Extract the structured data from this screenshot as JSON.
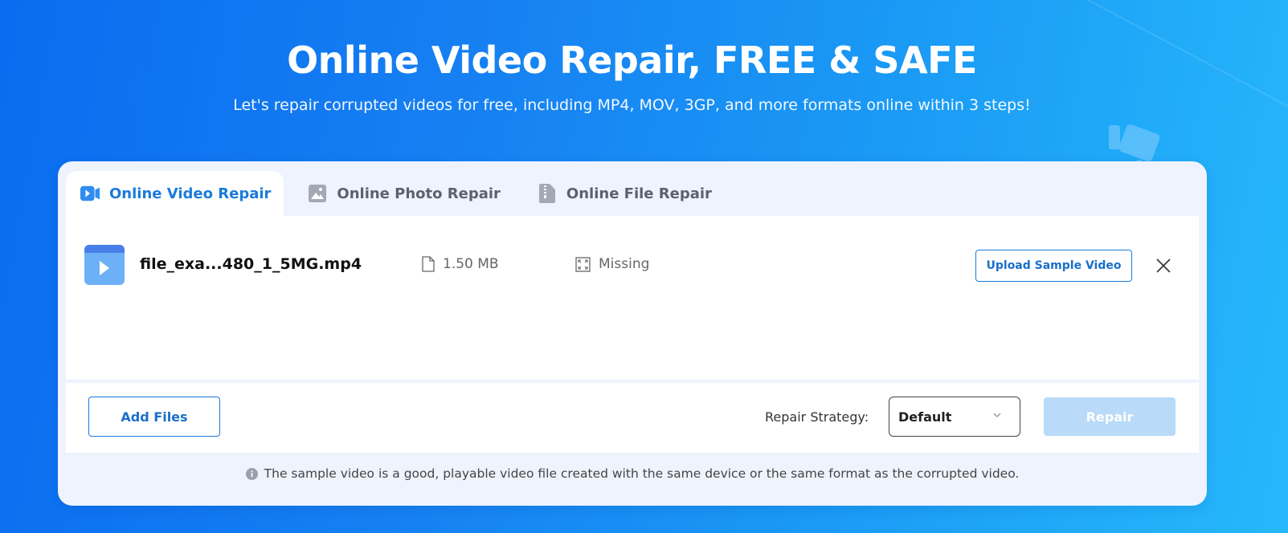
{
  "hero": {
    "title": "Online Video Repair, FREE & SAFE",
    "subtitle": "Let's repair corrupted videos for free, including MP4, MOV, 3GP, and more formats online within 3 steps!"
  },
  "tabs": [
    {
      "label": "Online Video Repair",
      "icon": "video-camera-icon",
      "active": true
    },
    {
      "label": "Online Photo Repair",
      "icon": "image-icon",
      "active": false
    },
    {
      "label": "Online File Repair",
      "icon": "zip-file-icon",
      "active": false
    }
  ],
  "file": {
    "name": "file_exa...480_1_5MG.mp4",
    "size": "1.50 MB",
    "status": "Missing",
    "upload_sample_label": "Upload Sample Video"
  },
  "actions": {
    "add_files_label": "Add Files",
    "strategy_label": "Repair Strategy:",
    "strategy_value": "Default",
    "repair_label": "Repair"
  },
  "note": "The sample video is a good, playable video file created with the same device or the same format as the corrupted video.",
  "colors": {
    "accent": "#1a7bdb",
    "repair_disabled": "#b9daf8",
    "card_bg": "#eef3fd"
  }
}
